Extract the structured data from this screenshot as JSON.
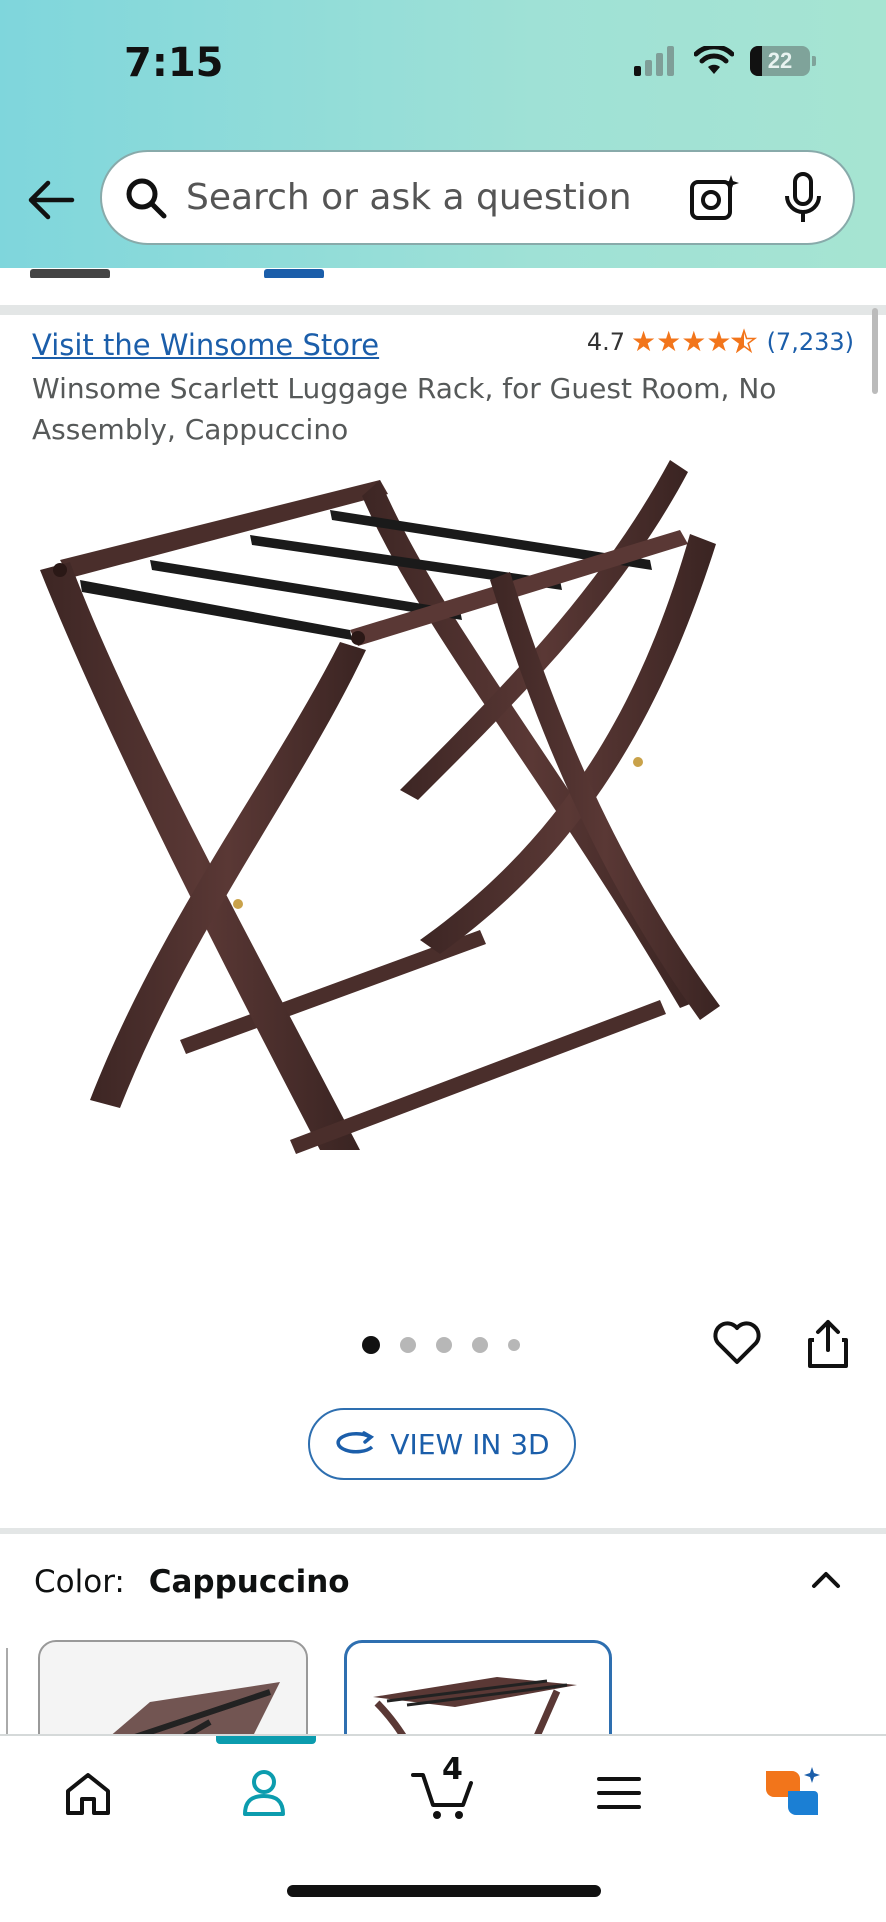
{
  "status_bar": {
    "time": "7:15",
    "battery": "22"
  },
  "search": {
    "placeholder": "Search or ask a question"
  },
  "product": {
    "store_link": "Visit the Winsome Store",
    "rating_value": "4.7",
    "rating_count": "(7,233)",
    "stars": 4.5,
    "title": "Winsome Scarlett Luggage Rack, for Guest Room, No Assembly, Cappuccino",
    "image_count": 5,
    "active_image": 1,
    "view_3d_label": "VIEW IN 3D"
  },
  "color": {
    "label": "Color:",
    "value": "Cappuccino"
  },
  "nav": {
    "cart_count": "4",
    "active": "account"
  },
  "colors": {
    "accent_blue": "#1b5eaa",
    "star_orange": "#f2751b",
    "nav_teal": "#0c9cae"
  }
}
